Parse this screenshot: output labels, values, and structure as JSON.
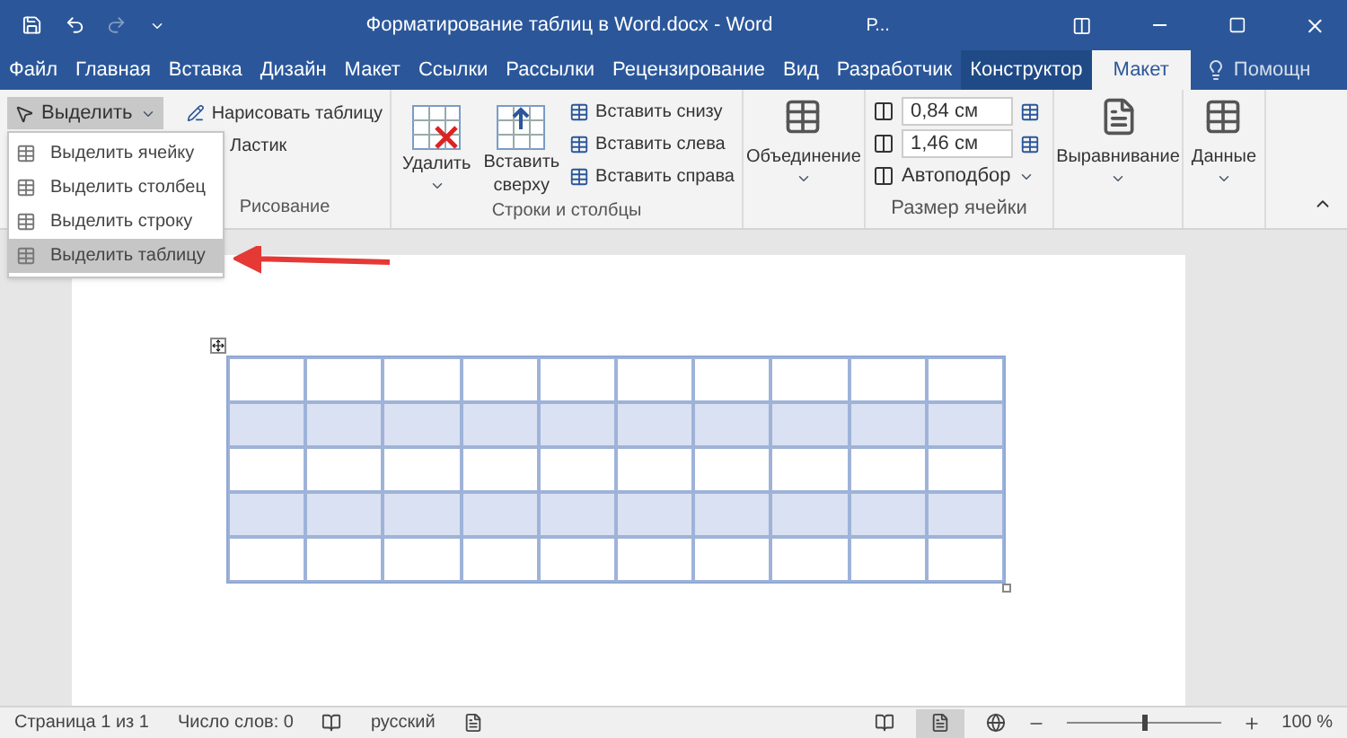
{
  "title_bar": {
    "title": "Форматирование таблиц в Word.docx - Word",
    "account": "Р..."
  },
  "tabs": [
    {
      "label": "Файл",
      "selected": false,
      "kind": "standard"
    },
    {
      "label": "Главная",
      "selected": false,
      "kind": "standard"
    },
    {
      "label": "Вставка",
      "selected": false,
      "kind": "standard"
    },
    {
      "label": "Дизайн",
      "selected": false,
      "kind": "standard"
    },
    {
      "label": "Макет",
      "selected": false,
      "kind": "standard"
    },
    {
      "label": "Ссылки",
      "selected": false,
      "kind": "standard"
    },
    {
      "label": "Рассылки",
      "selected": false,
      "kind": "standard"
    },
    {
      "label": "Рецензирование",
      "selected": false,
      "kind": "standard"
    },
    {
      "label": "Вид",
      "selected": false,
      "kind": "standard"
    },
    {
      "label": "Разработчик",
      "selected": false,
      "kind": "standard"
    },
    {
      "label": "Конструктор",
      "selected": false,
      "kind": "contextual"
    },
    {
      "label": "Макет",
      "selected": true,
      "kind": "contextual"
    }
  ],
  "help": "Помощн",
  "ribbon": {
    "select_button": "Выделить",
    "select_menu": [
      {
        "label": "Выделить ячейку",
        "selected": false
      },
      {
        "label": "Выделить столбец",
        "selected": false
      },
      {
        "label": "Выделить строку",
        "selected": false
      },
      {
        "label": "Выделить таблицу",
        "selected": true
      }
    ],
    "draw_group": {
      "label": "Рисование",
      "draw_table": "Нарисовать таблицу",
      "eraser": "Ластик"
    },
    "rows_group": {
      "label": "Строки и столбцы",
      "delete": "Удалить",
      "insert_above": "Вставить сверху",
      "insert_below": "Вставить снизу",
      "insert_left": "Вставить слева",
      "insert_right": "Вставить справа"
    },
    "merge": "Объединение",
    "size_group": {
      "label": "Размер ячейки",
      "height": "0,84 см",
      "width": "1,46 см",
      "autofit": "Автоподбор"
    },
    "alignment": "Выравнивание",
    "data": "Данные"
  },
  "table": {
    "rows": [
      {
        "shaded": false
      },
      {
        "shaded": true
      },
      {
        "shaded": false
      },
      {
        "shaded": true
      },
      {
        "shaded": false
      }
    ]
  },
  "status_bar": {
    "page": "Страница 1 из 1",
    "words": "Число слов: 0",
    "language": "русский",
    "zoom": {
      "level": 0.5,
      "reading": "100 %"
    }
  }
}
